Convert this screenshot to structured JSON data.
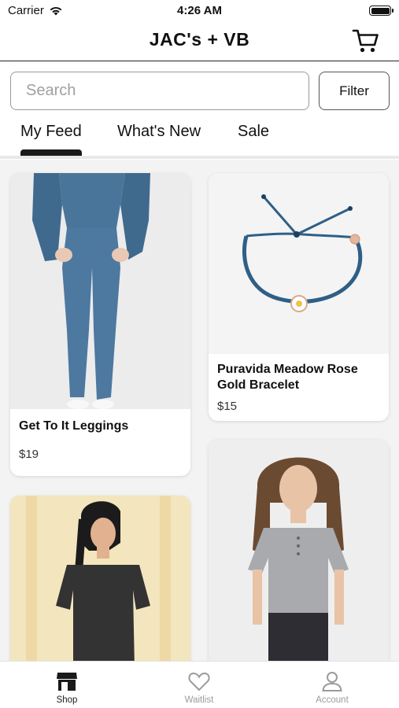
{
  "status_bar": {
    "carrier": "Carrier",
    "time": "4:26 AM"
  },
  "nav": {
    "title": "JAC's + VB",
    "cart_icon": "cart-icon"
  },
  "search": {
    "placeholder": "Search",
    "value": "",
    "filter_label": "Filter"
  },
  "tabs": {
    "items": [
      {
        "label": "My Feed"
      },
      {
        "label": "What's New"
      },
      {
        "label": "Sale"
      }
    ],
    "active": "My Feed"
  },
  "products": [
    {
      "title": "Get To It Leggings",
      "price": "$19"
    },
    {
      "title": "Puravida Meadow Rose Gold Bracelet",
      "price": "$15"
    },
    {
      "title": "",
      "price": ""
    },
    {
      "title": "",
      "price": ""
    }
  ],
  "tab_bar": {
    "items": [
      {
        "label": "Shop"
      },
      {
        "label": "Waitlist"
      },
      {
        "label": "Account"
      }
    ],
    "active": "Shop"
  },
  "colors": {
    "accent": "#1a1a1a",
    "inactive": "#9b9b9b",
    "feed_bg": "#f3f3f3"
  }
}
